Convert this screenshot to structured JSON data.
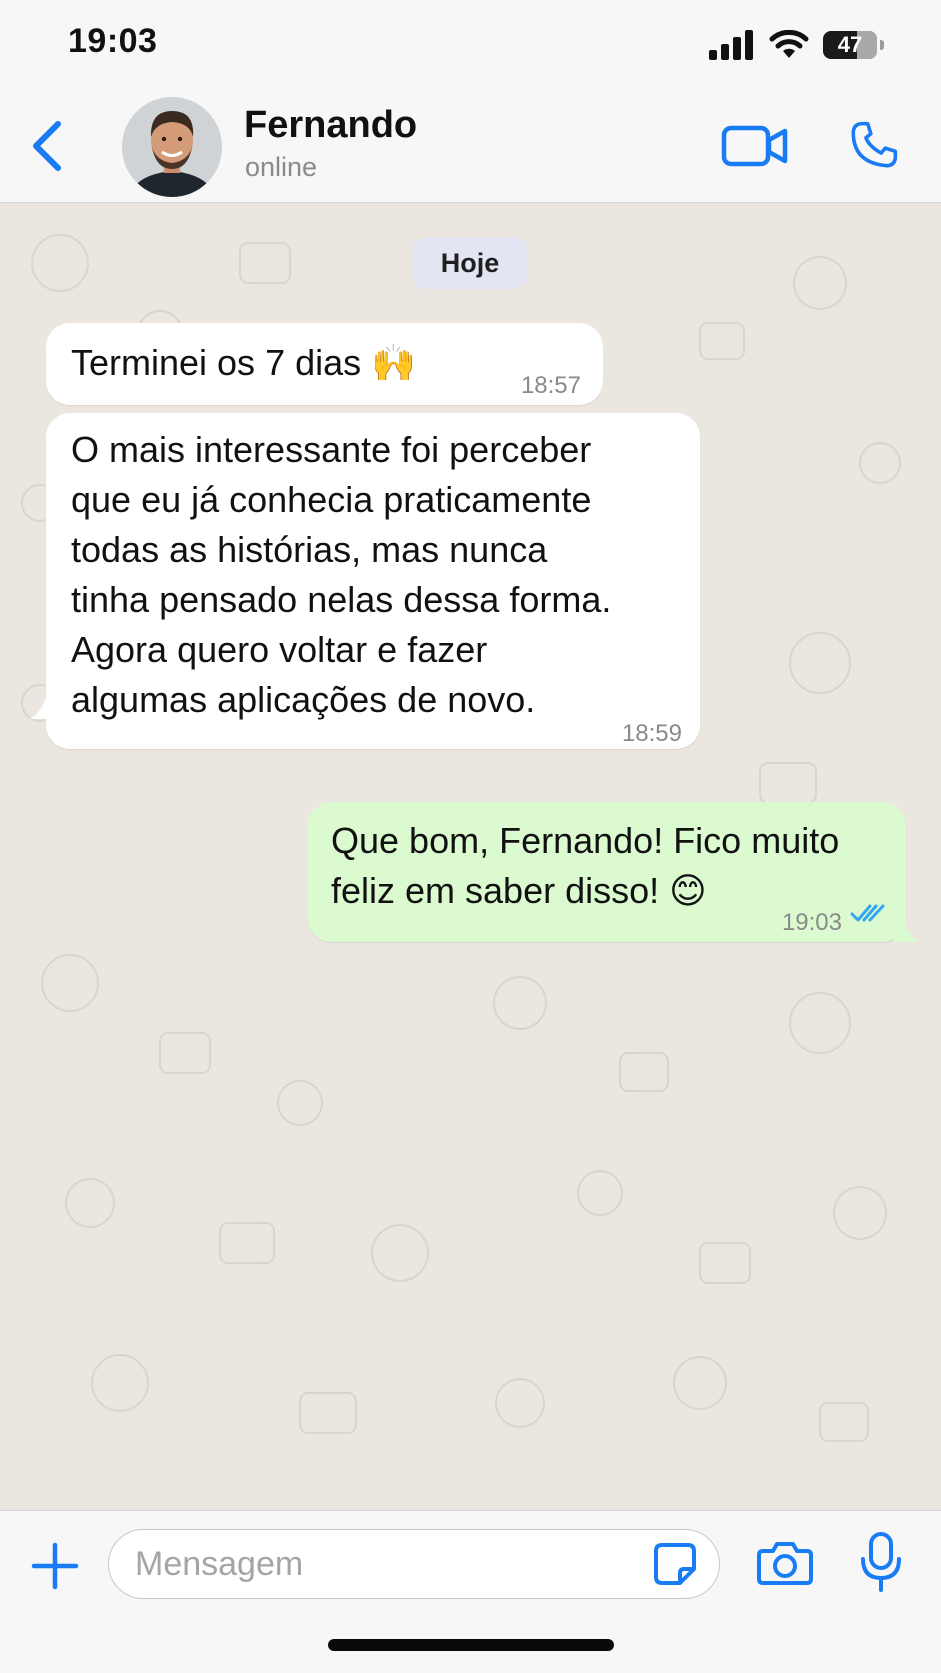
{
  "status_bar": {
    "time": "19:03",
    "battery": "47"
  },
  "header": {
    "contact_name": "Fernando",
    "contact_status": "online"
  },
  "chat": {
    "date_chip": "Hoje",
    "messages": [
      {
        "direction": "in",
        "text": "Terminei os 7 dias 🙌",
        "time": "18:57"
      },
      {
        "direction": "in",
        "text": "O mais interessante foi perceber\nque eu já conhecia praticamente\ntodas as histórias, mas nunca\ntinha pensado nelas dessa forma.\nAgora quero voltar e fazer\nalgumas aplicações de novo.",
        "time": "18:59"
      },
      {
        "direction": "out",
        "text": "Que bom, Fernando! Fico muito\nfeliz em saber disso! 😊",
        "time": "19:03",
        "status": "read"
      }
    ]
  },
  "input": {
    "placeholder": "Mensagem",
    "value": ""
  },
  "colors": {
    "accent": "#1a7cf5",
    "incoming_bubble": "#ffffff",
    "outgoing_bubble": "#dcfad0",
    "chat_bg": "#ebe6df",
    "read_ticks": "#34a6f0"
  },
  "icons": [
    "back-chevron-icon",
    "video-camera-icon",
    "phone-icon",
    "plus-icon",
    "sticker-icon",
    "camera-icon",
    "microphone-icon",
    "double-check-icon",
    "signal-icon",
    "wifi-icon",
    "battery-icon"
  ]
}
